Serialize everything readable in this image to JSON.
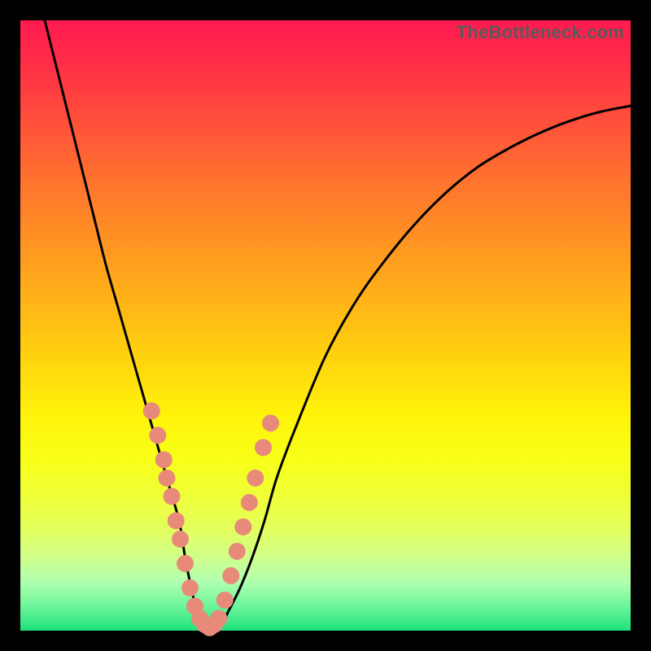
{
  "watermark": "TheBottleneck.com",
  "colors": {
    "background_outer": "#000000",
    "gradient_top": "#ff1a50",
    "gradient_bottom": "#1ee27a",
    "curve": "#000000",
    "marker": "#e88a7a"
  },
  "chart_data": {
    "type": "line",
    "title": "",
    "xlabel": "",
    "ylabel": "",
    "xlim": [
      0,
      100
    ],
    "ylim": [
      0,
      100
    ],
    "note": "Axes are unlabeled; values are estimated from pixel positions on a 0–100 normalized grid. y is plotted with origin at bottom (higher y = higher on image).",
    "series": [
      {
        "name": "curve",
        "x": [
          4,
          6,
          8,
          10,
          12,
          14,
          16,
          18,
          20,
          22,
          24,
          26,
          27,
          28,
          29,
          30,
          31,
          33,
          34,
          36,
          38,
          40,
          42,
          45,
          50,
          55,
          60,
          65,
          70,
          75,
          80,
          85,
          90,
          95,
          100
        ],
        "y": [
          100,
          92,
          84,
          76,
          68,
          60,
          53,
          46,
          39,
          32,
          25,
          18,
          12,
          7,
          3,
          1,
          0.5,
          1,
          3,
          7,
          12,
          18,
          25,
          33,
          45,
          54,
          61,
          67,
          72,
          76,
          79,
          81.5,
          83.5,
          85,
          86
        ]
      }
    ],
    "markers": {
      "name": "highlighted-points",
      "points": [
        {
          "x": 21.5,
          "y": 36
        },
        {
          "x": 22.5,
          "y": 32
        },
        {
          "x": 23.5,
          "y": 28
        },
        {
          "x": 24.0,
          "y": 25
        },
        {
          "x": 24.8,
          "y": 22
        },
        {
          "x": 25.5,
          "y": 18
        },
        {
          "x": 26.2,
          "y": 15
        },
        {
          "x": 27.0,
          "y": 11
        },
        {
          "x": 27.8,
          "y": 7
        },
        {
          "x": 28.6,
          "y": 4
        },
        {
          "x": 29.4,
          "y": 2
        },
        {
          "x": 30.2,
          "y": 1
        },
        {
          "x": 31.0,
          "y": 0.5
        },
        {
          "x": 31.8,
          "y": 1
        },
        {
          "x": 32.5,
          "y": 2
        },
        {
          "x": 33.5,
          "y": 5
        },
        {
          "x": 34.5,
          "y": 9
        },
        {
          "x": 35.5,
          "y": 13
        },
        {
          "x": 36.5,
          "y": 17
        },
        {
          "x": 37.5,
          "y": 21
        },
        {
          "x": 38.5,
          "y": 25
        },
        {
          "x": 39.8,
          "y": 30
        },
        {
          "x": 41.0,
          "y": 34
        }
      ],
      "radius": 10
    }
  }
}
